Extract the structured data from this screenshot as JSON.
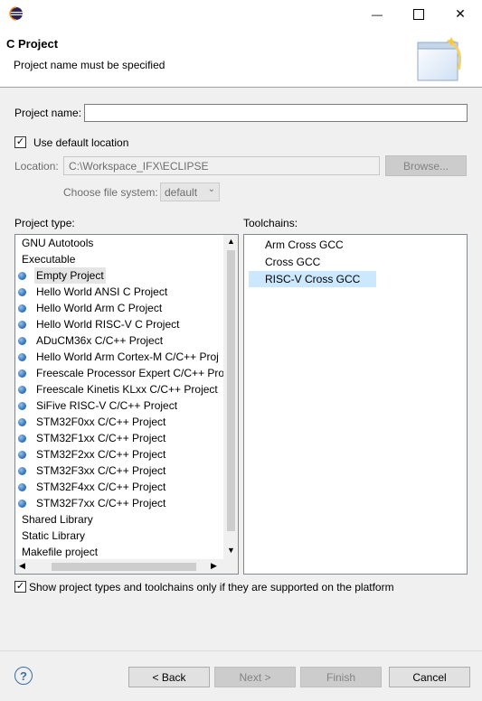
{
  "window": {
    "title": "",
    "minimize_glyph": "—",
    "maximize_glyph": "☐",
    "close_glyph": "✕"
  },
  "header": {
    "title": "C Project",
    "message": "Project name must be specified"
  },
  "form": {
    "project_name_label": "Project name:",
    "project_name_value": "",
    "use_default_location_label": "Use default location",
    "use_default_location_checked": true,
    "location_label": "Location:",
    "location_value": "C:\\Workspace_IFX\\ECLIPSE",
    "browse_label": "Browse...",
    "file_system_label": "Choose file system:",
    "file_system_value": "default"
  },
  "project_type": {
    "label": "Project type:",
    "items": [
      {
        "label": "GNU Autotools",
        "icon": false
      },
      {
        "label": "Executable",
        "icon": false
      },
      {
        "label": "Empty Project",
        "icon": true,
        "selected": true
      },
      {
        "label": "Hello World ANSI C Project",
        "icon": true
      },
      {
        "label": "Hello World Arm C Project",
        "icon": true
      },
      {
        "label": "Hello World RISC-V C Project",
        "icon": true
      },
      {
        "label": "ADuCM36x C/C++ Project",
        "icon": true
      },
      {
        "label": "Hello World Arm Cortex-M C/C++ Proj",
        "icon": true
      },
      {
        "label": "Freescale Processor Expert C/C++ Proje",
        "icon": true
      },
      {
        "label": "Freescale Kinetis KLxx C/C++ Project",
        "icon": true
      },
      {
        "label": "SiFive RISC-V C/C++ Project",
        "icon": true
      },
      {
        "label": "STM32F0xx C/C++ Project",
        "icon": true
      },
      {
        "label": "STM32F1xx C/C++ Project",
        "icon": true
      },
      {
        "label": "STM32F2xx C/C++ Project",
        "icon": true
      },
      {
        "label": "STM32F3xx C/C++ Project",
        "icon": true
      },
      {
        "label": "STM32F4xx C/C++ Project",
        "icon": true
      },
      {
        "label": "STM32F7xx C/C++ Project",
        "icon": true
      },
      {
        "label": "Shared Library",
        "icon": false
      },
      {
        "label": "Static Library",
        "icon": false
      },
      {
        "label": "Makefile project",
        "icon": false
      }
    ]
  },
  "toolchains": {
    "label": "Toolchains:",
    "items": [
      {
        "label": "Arm Cross GCC"
      },
      {
        "label": "Cross GCC"
      },
      {
        "label": "RISC-V Cross GCC",
        "selected": true
      }
    ]
  },
  "filter": {
    "label": "Show project types and toolchains only if they are supported on the platform",
    "checked": true
  },
  "footer": {
    "help_glyph": "?",
    "back_label": "< Back",
    "next_label": "Next >",
    "finish_label": "Finish",
    "cancel_label": "Cancel"
  },
  "colors": {
    "selection_blue": "#cce8ff",
    "selection_gray": "#e5e5e5",
    "bullet_blue": "#3a7bc3"
  }
}
